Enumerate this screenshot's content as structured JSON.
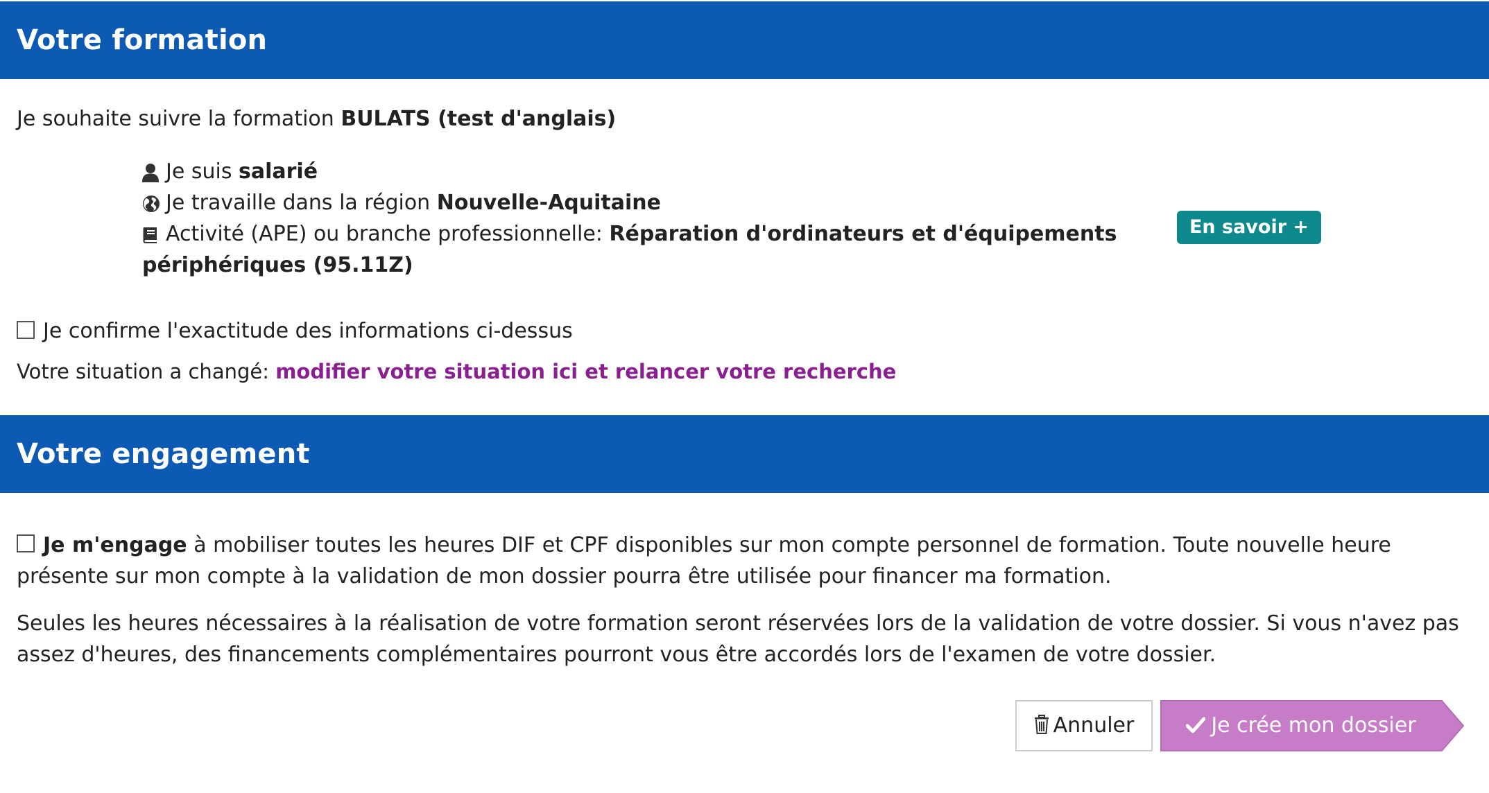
{
  "formation_section": {
    "title": "Votre formation",
    "intro_prefix": "Je souhaite suivre la formation ",
    "training_name": "BULATS (test d'anglais)",
    "status_prefix": "Je suis ",
    "status_value": "salarié",
    "region_prefix": "Je travaille dans la région ",
    "region_value": "Nouvelle-Aquitaine",
    "activity_prefix": "Activité (APE) ou branche professionnelle: ",
    "activity_value_line1": "Réparation d'ordinateurs et d'équipements",
    "activity_value_line2": "périphériques (95.11Z)",
    "more_button": "En savoir +",
    "confirm_label": "Je confirme l'exactitude des informations ci-dessus",
    "changed_prefix": "Votre situation a changé: ",
    "changed_link": "modifier votre situation ici et relancer votre recherche"
  },
  "engagement_section": {
    "title": "Votre engagement",
    "engage_bold": "Je m'engage",
    "engage_text": " à mobiliser toutes les heures DIF et CPF disponibles sur mon compte personnel de formation. Toute nouvelle heure présente sur mon compte à la validation de mon dossier pourra être utilisée pour financer ma formation.",
    "note_text": "Seules les heures nécessaires à la réalisation de votre formation seront réservées lors de la validation de votre dossier. Si vous n'avez pas assez d'heures, des financements complémentaires pourront vous être accordés lors de l'examen de votre dossier."
  },
  "actions": {
    "cancel_label": "Annuler",
    "create_label": "Je crée mon dossier"
  },
  "icons": {
    "status": "user-icon",
    "region": "globe-icon",
    "activity": "book-icon",
    "cancel": "trash-icon",
    "create": "checkmark-icon"
  },
  "colors": {
    "header_band": "#0d5ab4",
    "more_button": "#0e8a8f",
    "link": "#8a1f92",
    "create_button": "#c77cc7"
  }
}
